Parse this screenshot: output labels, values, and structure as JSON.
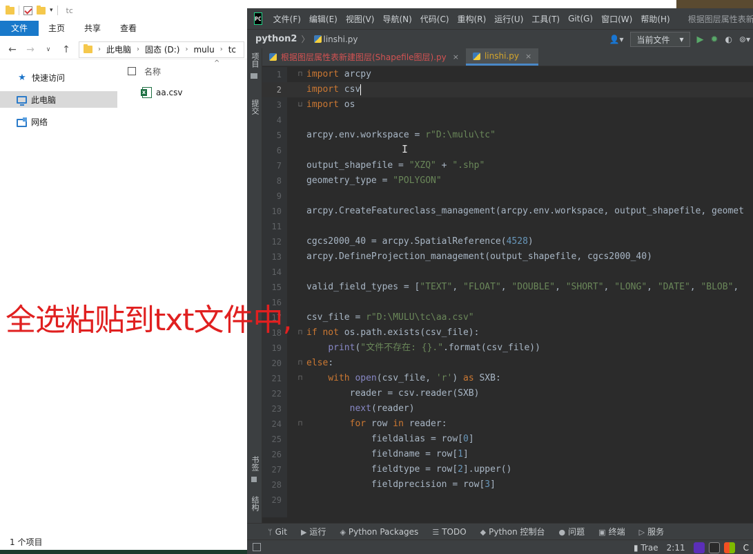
{
  "explorer": {
    "title": "tc",
    "ribbon_tabs": [
      "文件",
      "主页",
      "共享",
      "查看"
    ],
    "breadcrumb": [
      "此电脑",
      "固态 (D:)",
      "mulu",
      "tc"
    ],
    "nav": [
      {
        "label": "快速访问"
      },
      {
        "label": "此电脑"
      },
      {
        "label": "网络"
      }
    ],
    "column_name": "名称",
    "files": [
      {
        "name": "aa.csv"
      }
    ],
    "status": "1 个项目"
  },
  "overlay_note": "全选粘贴到txt文件中,",
  "ide": {
    "menu": [
      "文件(F)",
      "编辑(E)",
      "视图(V)",
      "导航(N)",
      "代码(C)",
      "重构(R)",
      "运行(U)",
      "工具(T)",
      "Git(G)",
      "窗口(W)",
      "帮助(H)"
    ],
    "window_title": "根据图层属性表新",
    "project": "python2",
    "breadcrumb_file": "linshi.py",
    "run_config": "当前文件",
    "sidebar": {
      "project": "项目",
      "commit": "提交",
      "bookmarks": "书签",
      "structure": "结构"
    },
    "tabs": [
      {
        "label": "根据图层属性表新建图层(Shapefile图层).py",
        "active": false
      },
      {
        "label": "linshi.py",
        "active": true
      }
    ],
    "bottom_tools": [
      "Git",
      "运行",
      "Python Packages",
      "TODO",
      "Python 控制台",
      "问题",
      "终端",
      "服务"
    ],
    "status_right": {
      "ime": "Trae",
      "time": "2:11",
      "ime2": "C"
    },
    "colors": {
      "keyword": "#cc7832",
      "string": "#6a8759",
      "number": "#6897bb",
      "builtin": "#8888c6",
      "text": "#a9b7c6",
      "editor_bg": "#2b2b2b"
    }
  },
  "code_lines": [
    {
      "n": "1",
      "text": "import arcpy"
    },
    {
      "n": "2",
      "text": "import csv"
    },
    {
      "n": "3",
      "text": "import os"
    },
    {
      "n": "4",
      "text": ""
    },
    {
      "n": "5",
      "text": "arcpy.env.workspace = r\"D:\\mulu\\tc\""
    },
    {
      "n": "6",
      "text": ""
    },
    {
      "n": "7",
      "text": "output_shapefile = \"XZQ\" + \".shp\""
    },
    {
      "n": "8",
      "text": "geometry_type = \"POLYGON\""
    },
    {
      "n": "9",
      "text": ""
    },
    {
      "n": "10",
      "text": "arcpy.CreateFeatureclass_management(arcpy.env.workspace, output_shapefile, geomet"
    },
    {
      "n": "11",
      "text": ""
    },
    {
      "n": "12",
      "text": "cgcs2000_40 = arcpy.SpatialReference(4528)"
    },
    {
      "n": "13",
      "text": "arcpy.DefineProjection_management(output_shapefile, cgcs2000_40)"
    },
    {
      "n": "14",
      "text": ""
    },
    {
      "n": "15",
      "text": "valid_field_types = [\"TEXT\", \"FLOAT\", \"DOUBLE\", \"SHORT\", \"LONG\", \"DATE\", \"BLOB\","
    },
    {
      "n": "16",
      "text": ""
    },
    {
      "n": "17",
      "text": "csv_file = r\"D:\\MULU\\tc\\aa.csv\""
    },
    {
      "n": "18",
      "text": "if not os.path.exists(csv_file):"
    },
    {
      "n": "19",
      "text": "    print(\"文件不存在: {}.\".format(csv_file))"
    },
    {
      "n": "20",
      "text": "else:"
    },
    {
      "n": "21",
      "text": "    with open(csv_file, 'r') as SXB:"
    },
    {
      "n": "22",
      "text": "        reader = csv.reader(SXB)"
    },
    {
      "n": "23",
      "text": "        next(reader)"
    },
    {
      "n": "24",
      "text": "        for row in reader:"
    },
    {
      "n": "25",
      "text": "            fieldalias = row[0]"
    },
    {
      "n": "26",
      "text": "            fieldname = row[1]"
    },
    {
      "n": "27",
      "text": "            fieldtype = row[2].upper()"
    },
    {
      "n": "28",
      "text": "            fieldprecision = row[3]"
    },
    {
      "n": "29",
      "text": ""
    }
  ]
}
